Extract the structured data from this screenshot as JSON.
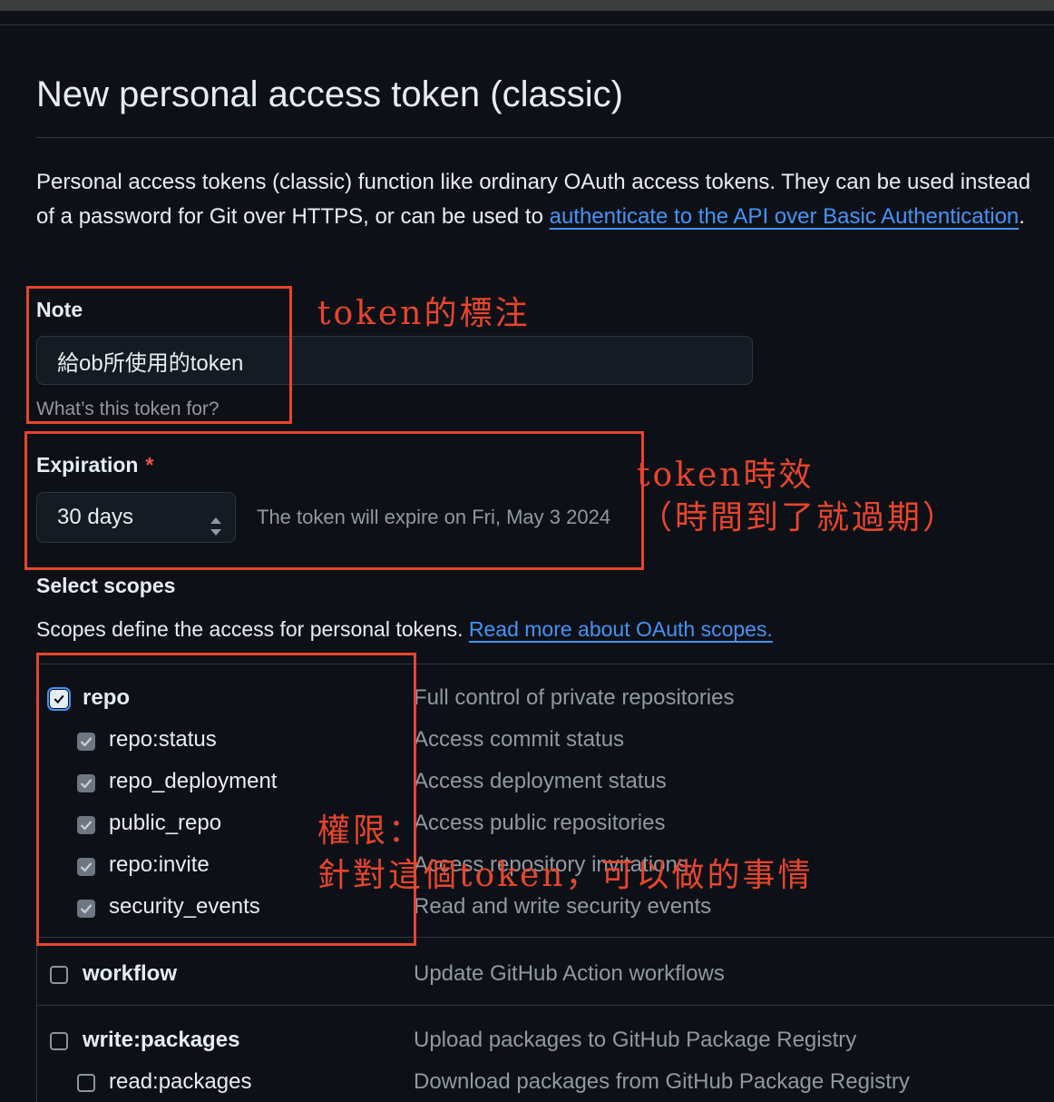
{
  "page": {
    "title": "New personal access token (classic)",
    "intro_text": "Personal access tokens (classic) function like ordinary OAuth access tokens. They can be used instead of a password for Git over HTTPS, or can be used to ",
    "intro_link": "authenticate to the API over Basic Authentication",
    "intro_end": "."
  },
  "note": {
    "label": "Note",
    "value": "給ob所使用的token",
    "hint": "What’s this token for?"
  },
  "expiration": {
    "label": "Expiration",
    "required_mark": "*",
    "selected": "30 days",
    "info": "The token will expire on Fri, May 3 2024"
  },
  "scopes": {
    "heading": "Select scopes",
    "description": "Scopes define the access for personal tokens. ",
    "link": "Read more about OAuth scopes.",
    "items": [
      {
        "name": "repo",
        "desc": "Full control of private repositories",
        "checked": true
      },
      {
        "name": "repo:status",
        "desc": "Access commit status",
        "checked": true
      },
      {
        "name": "repo_deployment",
        "desc": "Access deployment status",
        "checked": true
      },
      {
        "name": "public_repo",
        "desc": "Access public repositories",
        "checked": true
      },
      {
        "name": "repo:invite",
        "desc": "Access repository invitations",
        "checked": true
      },
      {
        "name": "security_events",
        "desc": "Read and write security events",
        "checked": true
      },
      {
        "name": "workflow",
        "desc": "Update GitHub Action workflows",
        "checked": false
      },
      {
        "name": "write:packages",
        "desc": "Upload packages to GitHub Package Registry",
        "checked": false
      },
      {
        "name": "read:packages",
        "desc": "Download packages from GitHub Package Registry",
        "checked": false
      }
    ]
  },
  "annotations": {
    "note": "token的標注",
    "expiration_line1": "token時效",
    "expiration_line2": "（時間到了就過期）",
    "scopes_line1": "權限：",
    "scopes_line2": "針對這個token，可以做的事情"
  },
  "colors": {
    "background": "#0d1117",
    "link": "#4493f8",
    "required": "#f85149",
    "annotation": "#e8452c"
  }
}
